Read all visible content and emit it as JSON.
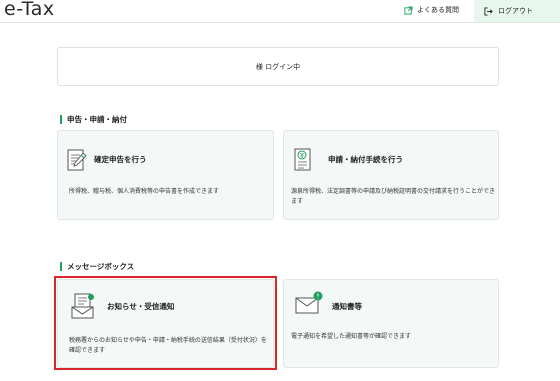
{
  "header": {
    "logo": "e-Tax",
    "faq_label": "よくある質問",
    "logout_label": "ログアウト"
  },
  "login_status": "様 ログイン中",
  "sections": {
    "filing": {
      "title": "申告・申請・納付",
      "cards": [
        {
          "title": "確定申告を行う",
          "description": "所得税、贈与税、個人消費税等の申告書を作成できます"
        },
        {
          "title": "申請・納付手続を行う",
          "description": "源泉所得税、法定調書等の申請及び納税証明書の交付請求を行うことができます"
        }
      ]
    },
    "messages": {
      "title": "メッセージボックス",
      "cards": [
        {
          "title": "お知らせ・受信通知",
          "description": "税務署からのお知らせや申告・申請・納税手続の送信結果（受付状況）を確認できます"
        },
        {
          "title": "通知書等",
          "description": "電子通知を希望した通知書等が確認できます"
        }
      ]
    }
  },
  "colors": {
    "accent": "#1ea05a",
    "highlight": "#d9262a",
    "card_bg": "#f4f8f6",
    "logout_bg": "#e8f7ee"
  }
}
